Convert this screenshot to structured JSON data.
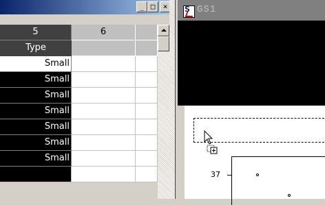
{
  "left_window": {
    "controls": {
      "minimize": "_",
      "maximize": "□",
      "close": "×"
    },
    "columns": [
      {
        "label": "5"
      },
      {
        "label": "6"
      }
    ],
    "type_header": "Type",
    "rows": [
      "Small",
      "Small",
      "Small",
      "Small",
      "Small",
      "Small",
      "Small"
    ]
  },
  "right_window": {
    "title": "GS1",
    "plot": {
      "y_tick_label": "37"
    }
  },
  "colors": {
    "titlebar_active": "#0a246a",
    "titlebar_inactive": "#808080",
    "face": "#d4d0c8"
  }
}
